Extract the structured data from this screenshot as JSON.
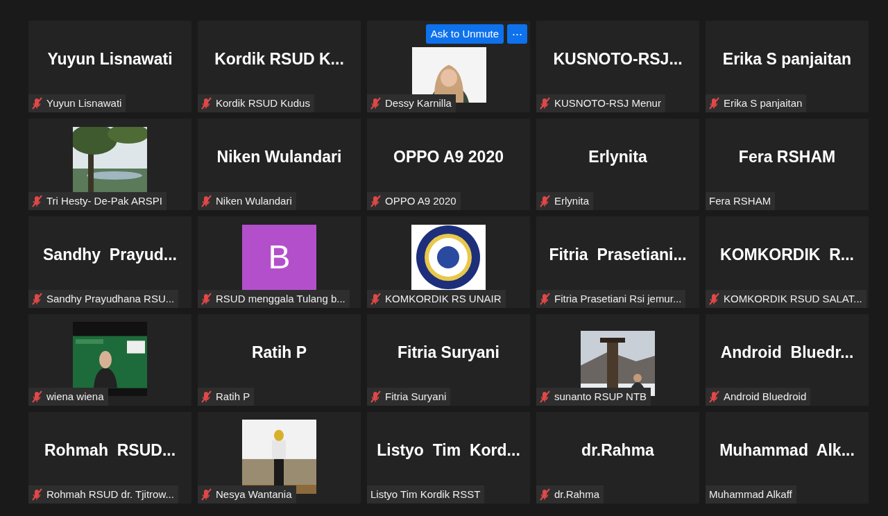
{
  "tiles": [
    {
      "kind": "name",
      "display": "Yuyun Lisnawati",
      "label": "Yuyun Lisnawati",
      "muted": true
    },
    {
      "kind": "name",
      "display": "Kordik RSUD K...",
      "label": "Kordik RSUD Kudus",
      "muted": true
    },
    {
      "kind": "picture",
      "label": "Dessy Karnilla",
      "muted": true,
      "buttons": [
        "Ask to Unmute",
        "⋯"
      ]
    },
    {
      "kind": "name",
      "display": "KUSNOTO-RSJ...",
      "label": "KUSNOTO-RSJ Menur",
      "muted": true
    },
    {
      "kind": "name",
      "display": "Erika S panjaitan",
      "label": "Erika S panjaitan",
      "muted": true
    },
    {
      "kind": "picture",
      "label": "Tri Hesty- De-Pak ARSPI",
      "muted": true
    },
    {
      "kind": "name",
      "display": "Niken Wulandari",
      "label": "Niken Wulandari",
      "muted": true
    },
    {
      "kind": "name",
      "display": "OPPO A9 2020",
      "label": "OPPO A9 2020",
      "muted": true
    },
    {
      "kind": "name",
      "display": "Erlynita",
      "label": "Erlynita",
      "muted": true
    },
    {
      "kind": "name",
      "display": "Fera RSHAM",
      "label": "Fera RSHAM",
      "muted": false
    },
    {
      "kind": "name",
      "display": "Sandhy  Prayud...",
      "label": "Sandhy Prayudhana RSU...",
      "muted": true
    },
    {
      "kind": "letter",
      "display": "B",
      "label": "RSUD menggala Tulang b...",
      "muted": true
    },
    {
      "kind": "picture",
      "label": "KOMKORDIK RS UNAIR",
      "muted": true
    },
    {
      "kind": "name",
      "display": "Fitria  Prasetiani...",
      "label": "Fitria Prasetiani Rsi jemur...",
      "muted": true
    },
    {
      "kind": "name",
      "display": "KOMKORDIK  R...",
      "label": "KOMKORDIK RSUD SALAT...",
      "muted": true
    },
    {
      "kind": "picture",
      "label": "wiena wiena",
      "muted": true
    },
    {
      "kind": "name",
      "display": "Ratih P",
      "label": "Ratih P",
      "muted": true
    },
    {
      "kind": "name",
      "display": "Fitria Suryani",
      "label": "Fitria Suryani",
      "muted": true
    },
    {
      "kind": "picture",
      "label": "sunanto RSUP NTB",
      "muted": true
    },
    {
      "kind": "name",
      "display": "Android  Bluedr...",
      "label": "Android Bluedroid",
      "muted": true
    },
    {
      "kind": "name",
      "display": "Rohmah  RSUD...",
      "label": "Rohmah RSUD dr. Tjitrow...",
      "muted": true
    },
    {
      "kind": "picture",
      "label": "Nesya Wantania",
      "muted": true
    },
    {
      "kind": "name",
      "display": "Listyo  Tim  Kord...",
      "label": "Listyo Tim Kordik RSST",
      "muted": false
    },
    {
      "kind": "name",
      "display": "dr.Rahma",
      "label": "dr.Rahma",
      "muted": true
    },
    {
      "kind": "name",
      "display": "Muhammad  Alk...",
      "label": "Muhammad Alkaff",
      "muted": false
    }
  ]
}
